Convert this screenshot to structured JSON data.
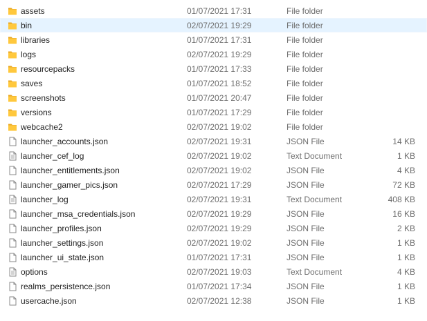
{
  "files": [
    {
      "name": "assets",
      "date": "01/07/2021 17:31",
      "type": "File folder",
      "size": "",
      "icon": "folder-icon"
    },
    {
      "name": "bin",
      "date": "02/07/2021 19:29",
      "type": "File folder",
      "size": "",
      "icon": "folder-icon",
      "selected": true
    },
    {
      "name": "libraries",
      "date": "01/07/2021 17:31",
      "type": "File folder",
      "size": "",
      "icon": "folder-icon"
    },
    {
      "name": "logs",
      "date": "02/07/2021 19:29",
      "type": "File folder",
      "size": "",
      "icon": "folder-icon"
    },
    {
      "name": "resourcepacks",
      "date": "01/07/2021 17:33",
      "type": "File folder",
      "size": "",
      "icon": "folder-icon"
    },
    {
      "name": "saves",
      "date": "01/07/2021 18:52",
      "type": "File folder",
      "size": "",
      "icon": "folder-icon"
    },
    {
      "name": "screenshots",
      "date": "01/07/2021 20:47",
      "type": "File folder",
      "size": "",
      "icon": "folder-icon"
    },
    {
      "name": "versions",
      "date": "01/07/2021 17:29",
      "type": "File folder",
      "size": "",
      "icon": "folder-icon"
    },
    {
      "name": "webcache2",
      "date": "02/07/2021 19:02",
      "type": "File folder",
      "size": "",
      "icon": "folder-icon"
    },
    {
      "name": "launcher_accounts.json",
      "date": "02/07/2021 19:31",
      "type": "JSON File",
      "size": "14 KB",
      "icon": "file-icon"
    },
    {
      "name": "launcher_cef_log",
      "date": "02/07/2021 19:02",
      "type": "Text Document",
      "size": "1 KB",
      "icon": "text-file-icon"
    },
    {
      "name": "launcher_entitlements.json",
      "date": "02/07/2021 19:02",
      "type": "JSON File",
      "size": "4 KB",
      "icon": "file-icon"
    },
    {
      "name": "launcher_gamer_pics.json",
      "date": "02/07/2021 17:29",
      "type": "JSON File",
      "size": "72 KB",
      "icon": "file-icon"
    },
    {
      "name": "launcher_log",
      "date": "02/07/2021 19:31",
      "type": "Text Document",
      "size": "408 KB",
      "icon": "text-file-icon"
    },
    {
      "name": "launcher_msa_credentials.json",
      "date": "02/07/2021 19:29",
      "type": "JSON File",
      "size": "16 KB",
      "icon": "file-icon"
    },
    {
      "name": "launcher_profiles.json",
      "date": "02/07/2021 19:29",
      "type": "JSON File",
      "size": "2 KB",
      "icon": "file-icon"
    },
    {
      "name": "launcher_settings.json",
      "date": "02/07/2021 19:02",
      "type": "JSON File",
      "size": "1 KB",
      "icon": "file-icon"
    },
    {
      "name": "launcher_ui_state.json",
      "date": "01/07/2021 17:31",
      "type": "JSON File",
      "size": "1 KB",
      "icon": "file-icon"
    },
    {
      "name": "options",
      "date": "02/07/2021 19:03",
      "type": "Text Document",
      "size": "4 KB",
      "icon": "text-file-icon"
    },
    {
      "name": "realms_persistence.json",
      "date": "01/07/2021 17:34",
      "type": "JSON File",
      "size": "1 KB",
      "icon": "file-icon"
    },
    {
      "name": "usercache.json",
      "date": "02/07/2021 12:38",
      "type": "JSON File",
      "size": "1 KB",
      "icon": "file-icon"
    }
  ],
  "colors": {
    "folder": "#ffc83d",
    "folder_dark": "#e8a825",
    "selection": "#e5f3ff",
    "secondary_text": "#6d6d6d"
  }
}
